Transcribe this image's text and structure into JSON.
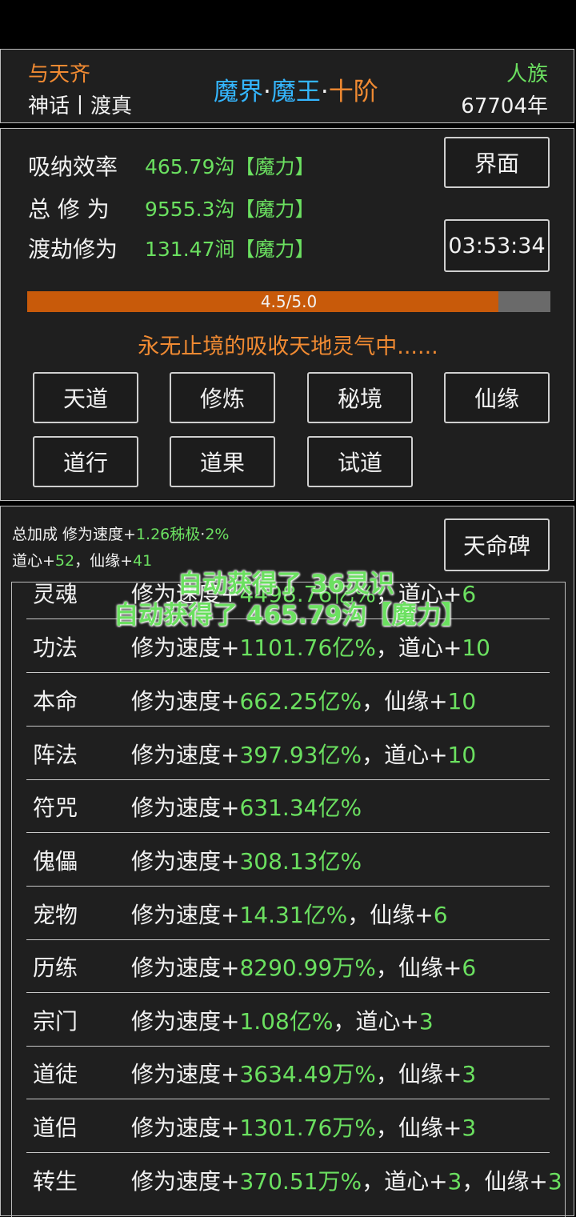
{
  "header": {
    "realm_title": "与天齐",
    "rank_line": "神话丨渡真",
    "center_part1": "魔界",
    "center_dot1": "·",
    "center_part2": "魔王",
    "center_dot2": "·",
    "center_part3": "十阶",
    "race": "人族",
    "years": "67704年"
  },
  "stats": {
    "rows": [
      {
        "label": "吸纳效率",
        "value": "465.79沟【魔力】"
      },
      {
        "label": "总 修 为",
        "value": "9555.3沟【魔力】"
      },
      {
        "label": "渡劫修为",
        "value": "131.47涧【魔力】"
      }
    ],
    "interface_button": "界面",
    "timer": "03:53:34",
    "progress_text": "4.5/5.0",
    "progress_fraction": 0.9,
    "status_text": "永无止境的吸收天地灵气中......"
  },
  "actions": [
    "天道",
    "修炼",
    "秘境",
    "仙缘",
    "道行",
    "道果",
    "试道"
  ],
  "bonus": {
    "line1_prefix": "总加成 修为速度+",
    "line1_value": "1.26秭极",
    "line1_dot": "·",
    "line1_pct": "2%",
    "line2_a": "道心+",
    "line2_a_val": "52",
    "line2_sep": "，仙缘+",
    "line2_b_val": "41",
    "stele_button": "天命碑"
  },
  "list": [
    {
      "name": "灵魂",
      "prefix": "修为速度+",
      "value": "4498.76亿%",
      "extra_label": "，道心+",
      "extra_val": "6",
      "extra2_label": "",
      "extra2_val": ""
    },
    {
      "name": "功法",
      "prefix": "修为速度+",
      "value": "1101.76亿%",
      "extra_label": "，道心+",
      "extra_val": "10",
      "extra2_label": "",
      "extra2_val": ""
    },
    {
      "name": "本命",
      "prefix": "修为速度+",
      "value": "662.25亿%",
      "extra_label": "，仙缘+",
      "extra_val": "10",
      "extra2_label": "",
      "extra2_val": ""
    },
    {
      "name": "阵法",
      "prefix": "修为速度+",
      "value": "397.93亿%",
      "extra_label": "，道心+",
      "extra_val": "10",
      "extra2_label": "",
      "extra2_val": ""
    },
    {
      "name": "符咒",
      "prefix": "修为速度+",
      "value": "631.34亿%",
      "extra_label": "",
      "extra_val": "",
      "extra2_label": "",
      "extra2_val": ""
    },
    {
      "name": "傀儡",
      "prefix": "修为速度+",
      "value": "308.13亿%",
      "extra_label": "",
      "extra_val": "",
      "extra2_label": "",
      "extra2_val": ""
    },
    {
      "name": "宠物",
      "prefix": "修为速度+",
      "value": "14.31亿%",
      "extra_label": "，仙缘+",
      "extra_val": "6",
      "extra2_label": "",
      "extra2_val": ""
    },
    {
      "name": "历练",
      "prefix": "修为速度+",
      "value": "8290.99万%",
      "extra_label": "，仙缘+",
      "extra_val": "6",
      "extra2_label": "",
      "extra2_val": ""
    },
    {
      "name": "宗门",
      "prefix": "修为速度+",
      "value": "1.08亿%",
      "extra_label": "，道心+",
      "extra_val": "3",
      "extra2_label": "",
      "extra2_val": ""
    },
    {
      "name": "道徒",
      "prefix": "修为速度+",
      "value": "3634.49万%",
      "extra_label": "，仙缘+",
      "extra_val": "3",
      "extra2_label": "",
      "extra2_val": ""
    },
    {
      "name": "道侣",
      "prefix": "修为速度+",
      "value": "1301.76万%",
      "extra_label": "，仙缘+",
      "extra_val": "3",
      "extra2_label": "",
      "extra2_val": ""
    },
    {
      "name": "转生",
      "prefix": "修为速度+",
      "value": "370.51万%",
      "extra_label": "，道心+",
      "extra_val": "3",
      "extra2_label": "，仙缘+",
      "extra2_val": "3"
    }
  ],
  "toasts": [
    "自动获得了 36灵识",
    "自动获得了 465.79沟【魔力】"
  ],
  "colors": {
    "orange": "#f08a32",
    "green": "#6be060",
    "blue": "#34b6ff",
    "progress": "#c85a0a"
  }
}
